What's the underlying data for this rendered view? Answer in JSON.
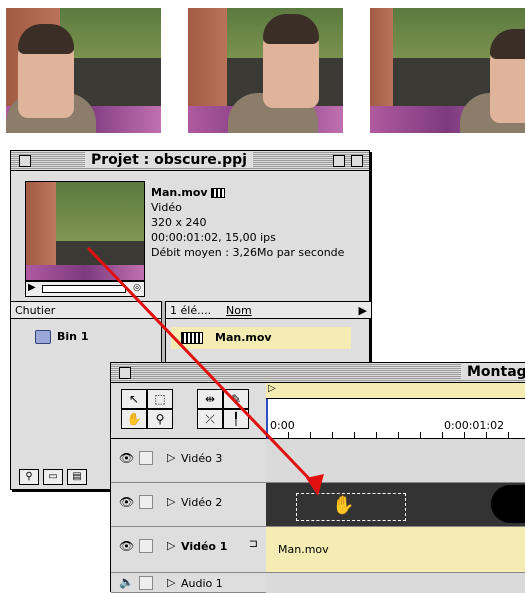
{
  "project": {
    "title": "Projet : obscure.ppj",
    "clip": {
      "name": "Man.mov",
      "type": "Vidéo",
      "size": "320 x 240",
      "duration": "00:00:01:02, 15,00 ips",
      "rate": "Débit moyen : 3,26Mo par seconde"
    },
    "bin_header": "Chutier",
    "count_header": "1 élé....",
    "name_header": "Nom",
    "bin_item": "Bin 1",
    "clip_item": "Man.mov"
  },
  "timeline": {
    "title": "Montag",
    "time_start": "0:00",
    "time_end": "0:00:01:02",
    "tracks": [
      {
        "label": "Vidéo 3"
      },
      {
        "label": "Vidéo 2"
      },
      {
        "label": "Vidéo 1"
      },
      {
        "label": "Audio 1"
      }
    ],
    "clip_label": "Man.mov"
  },
  "colors": {
    "arrow": "#e01010",
    "clip_fill": "#f4ecb2",
    "window_bg": "#dedede"
  }
}
